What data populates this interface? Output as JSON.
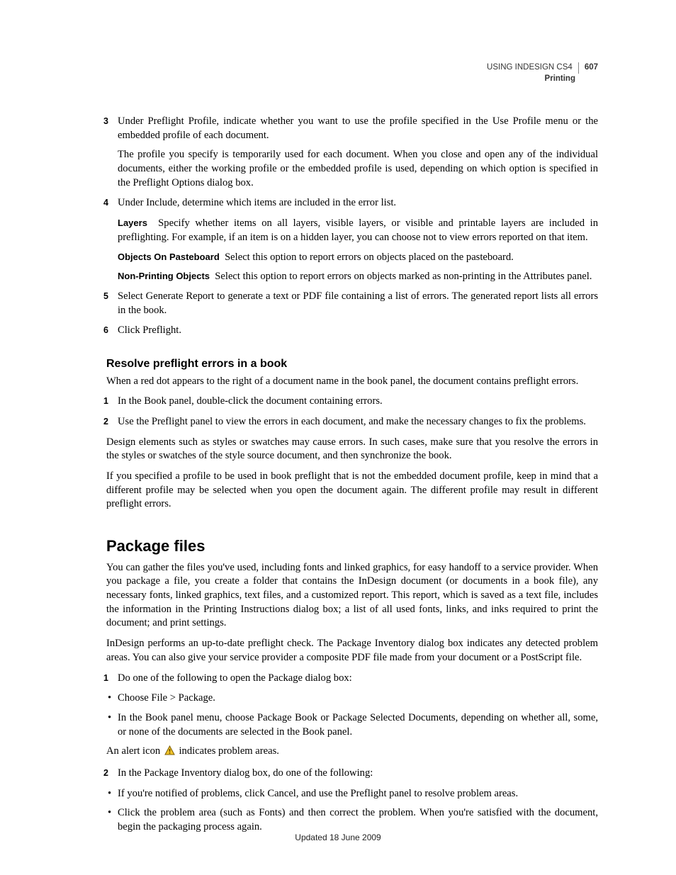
{
  "header": {
    "doc_title": "USING INDESIGN CS4",
    "section": "Printing",
    "page_number": "607"
  },
  "steps_a": {
    "s3": {
      "num": "3",
      "p1": "Under Preflight Profile, indicate whether you want to use the profile specified in the Use Profile menu or the embedded profile of each document.",
      "p2": "The profile you specify is temporarily used for each document. When you close and open any of the individual documents, either the working profile or the embedded profile is used, depending on which option is specified in the Preflight Options dialog box."
    },
    "s4": {
      "num": "4",
      "p1": "Under Include, determine which items are included in the error list.",
      "layers_label": "Layers",
      "layers_text": "Specify whether items on all layers, visible layers, or visible and printable layers are included in preflighting. For example, if an item is on a hidden layer, you can choose not to view errors reported on that item.",
      "paste_label": "Objects On Pasteboard",
      "paste_text": "Select this option to report errors on objects placed on the pasteboard.",
      "nonprint_label": "Non-Printing Objects",
      "nonprint_text": "Select this option to report errors on objects marked as non-printing in the Attributes panel."
    },
    "s5": {
      "num": "5",
      "p1": "Select Generate Report to generate a text or PDF file containing a list of errors. The generated report lists all errors in the book."
    },
    "s6": {
      "num": "6",
      "p1": "Click Preflight."
    }
  },
  "resolve": {
    "heading": "Resolve preflight errors in a book",
    "intro": "When a red dot appears to the right of a document name in the book panel, the document contains preflight errors.",
    "s1_num": "1",
    "s1": "In the Book panel, double-click the document containing errors.",
    "s2_num": "2",
    "s2": "Use the Preflight panel to view the errors in each document, and make the necessary changes to fix the problems.",
    "p3": "Design elements such as styles or swatches may cause errors. In such cases, make sure that you resolve the errors in the styles or swatches of the style source document, and then synchronize the book.",
    "p4": "If you specified a profile to be used in book preflight that is not the embedded document profile, keep in mind that a different profile may be selected when you open the document again. The different profile may result in different preflight errors."
  },
  "package": {
    "heading": "Package files",
    "p1": "You can gather the files you've used, including fonts and linked graphics, for easy handoff to a service provider. When you package a file, you create a folder that contains the InDesign document (or documents in a book file), any necessary fonts, linked graphics, text files, and a customized report. This report, which is saved as a text file, includes the information in the Printing Instructions dialog box; a list of all used fonts, links, and inks required to print the document; and print settings.",
    "p2": "InDesign performs an up-to-date preflight check. The Package Inventory dialog box indicates any detected problem areas. You can also give your service provider a composite PDF file made from your document or a PostScript file.",
    "s1_num": "1",
    "s1": "Do one of the following to open the Package dialog box:",
    "b1": "Choose File > Package.",
    "b2": "In the Book panel menu, choose Package Book or Package Selected Documents, depending on whether all, some, or none of the documents are selected in the Book panel.",
    "alert_pre": "An alert icon ",
    "alert_post": " indicates problem areas.",
    "s2_num": "2",
    "s2": "In the Package Inventory dialog box, do one of the following:",
    "b3": "If you're notified of problems, click Cancel, and use the Preflight panel to resolve problem areas.",
    "b4": "Click the problem area (such as Fonts) and then correct the problem. When you're satisfied with the document, begin the packaging process again."
  },
  "footer": "Updated 18 June 2009"
}
